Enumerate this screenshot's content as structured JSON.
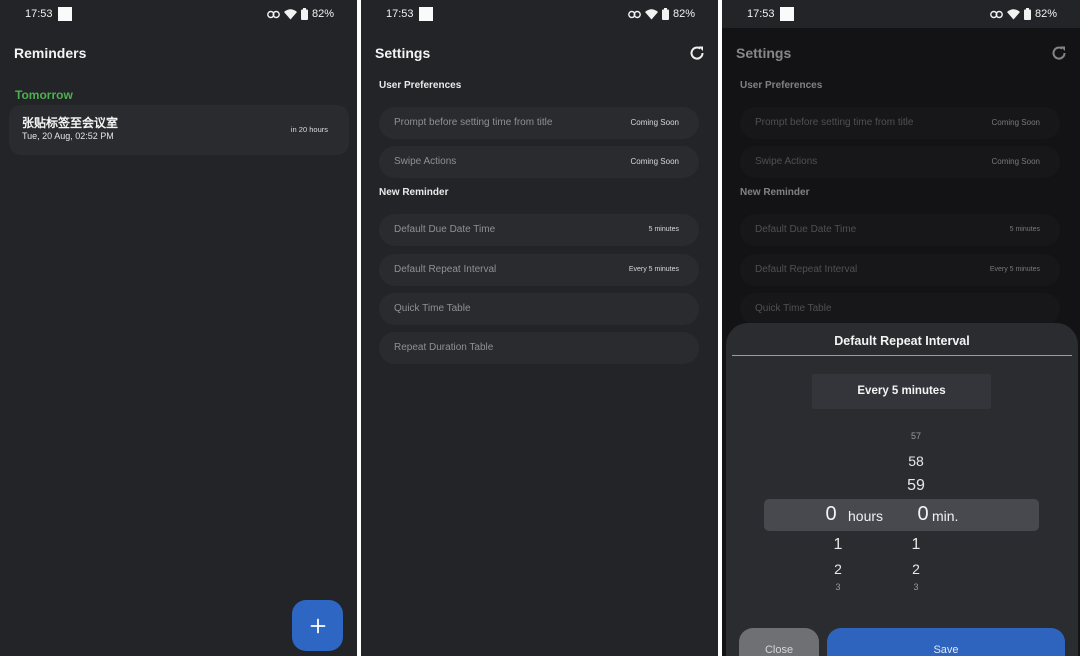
{
  "status_bar": {
    "time": "17:53",
    "battery": "82%"
  },
  "reminders_screen": {
    "title": "Reminders",
    "section": "Tomorrow",
    "reminder": {
      "title": "张贴标签至会议室",
      "date": "Tue, 20 Aug, 02:52 PM",
      "due": "in 20 hours"
    },
    "fab_icon": "plus-icon"
  },
  "settings": {
    "title": "Settings",
    "sections": {
      "user_preferences": "User Preferences",
      "new_reminder": "New Reminder"
    },
    "rows": {
      "prompt": {
        "label": "Prompt before setting time from title",
        "value": "Coming Soon"
      },
      "swipe": {
        "label": "Swipe Actions",
        "value": "Coming Soon"
      },
      "due": {
        "label": "Default Due Date Time",
        "value": "5 minutes"
      },
      "repeat": {
        "label": "Default Repeat Interval",
        "value": "Every 5 minutes"
      },
      "quick": {
        "label": "Quick Time Table"
      },
      "duration": {
        "label": "Repeat Duration Table"
      }
    }
  },
  "dialog": {
    "title": "Default Repeat Interval",
    "selected": "Every 5 minutes",
    "picker": {
      "hours": {
        "selected": "0",
        "unit": "hours",
        "below": [
          "1",
          "2",
          "3"
        ]
      },
      "minutes": {
        "selected": "0",
        "unit": "min.",
        "above": [
          "57",
          "58",
          "59"
        ],
        "below": [
          "1",
          "2",
          "3"
        ]
      }
    },
    "close_label": "Close",
    "save_label": "Save"
  },
  "colors": {
    "background": "#232427",
    "card": "#2a2b2f",
    "accent": "#2e66c4",
    "section_green": "#4fae52"
  }
}
